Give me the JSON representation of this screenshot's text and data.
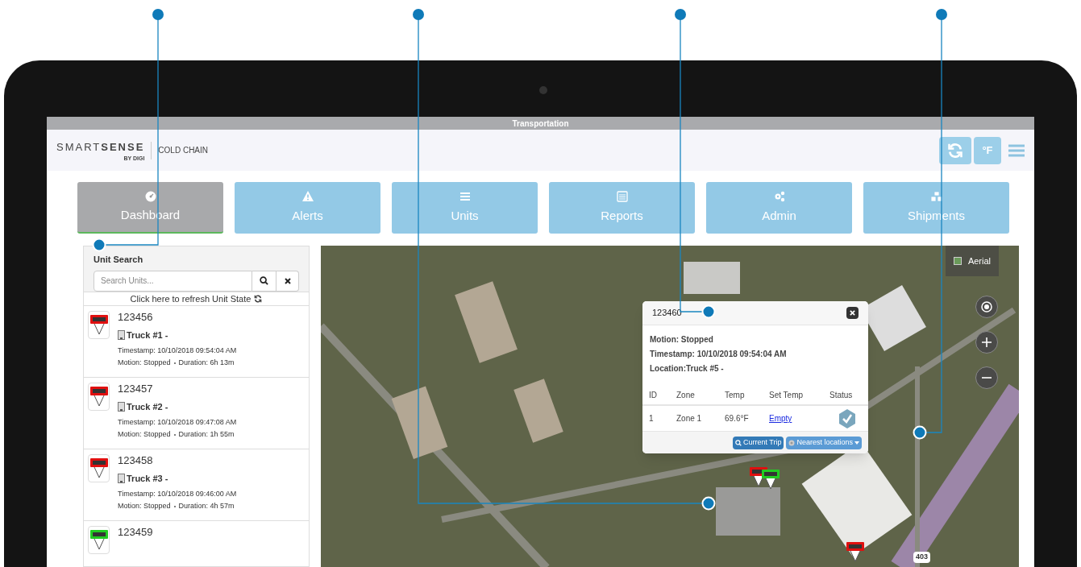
{
  "window": {
    "title": "Transportation"
  },
  "header": {
    "logo_light": "SMART",
    "logo_bold": "SENSE",
    "logo_sub": "BY DIGI",
    "product": "COLD CHAIN",
    "buttons": [
      {
        "kind": "refresh"
      },
      {
        "kind": "text",
        "label": "°F"
      },
      {
        "kind": "menu"
      }
    ]
  },
  "tabs": [
    {
      "label": "Dashboard",
      "selected": true
    },
    {
      "label": "Alerts",
      "selected": false
    },
    {
      "label": "Units",
      "selected": false
    },
    {
      "label": "Reports",
      "selected": false
    },
    {
      "label": "Admin",
      "selected": false
    },
    {
      "label": "Shipments",
      "selected": false
    }
  ],
  "sidebar": {
    "title": "Unit Search",
    "search": {
      "placeholder": "Search Units..."
    },
    "refresh_label": "Click here to refresh Unit State",
    "units": [
      {
        "id": "123456",
        "color": "#e01010",
        "name": "Truck #1 -",
        "timestamp": "Timestamp: 10/10/2018 09:54:04 AM",
        "motion": "Motion: Stopped",
        "duration": "Duration: 6h 13m"
      },
      {
        "id": "123457",
        "color": "#e01010",
        "name": "Truck #2 -",
        "timestamp": "Timestamp: 10/10/2018 09:47:08 AM",
        "motion": "Motion: Stopped",
        "duration": "Duration: 1h 55m"
      },
      {
        "id": "123458",
        "color": "#e01010",
        "name": "Truck #3 -",
        "timestamp": "Timestamp: 10/10/2018 09:46:00 AM",
        "motion": "Motion: Stopped",
        "duration": "Duration: 4h 57m"
      },
      {
        "id": "123459",
        "color": "#22cc22"
      }
    ]
  },
  "map": {
    "layer_button": "Aerial",
    "road_shield": "403",
    "markers": [
      {
        "color": "#e01010"
      },
      {
        "color": "#22cc22"
      },
      {
        "color": "#e01010"
      }
    ],
    "popup": {
      "title": "123460",
      "lines": [
        "Motion: Stopped",
        "Timestamp: 10/10/2018 09:54:04 AM",
        "Location:Truck #5 -"
      ],
      "columns": [
        "ID",
        "Zone",
        "Temp",
        "Set Temp",
        "Status"
      ],
      "rows": [
        {
          "id": "1",
          "zone": "Zone 1",
          "temp": "69.6°F",
          "set_temp": "Empty",
          "status_ok": true
        }
      ],
      "buttons": [
        {
          "kind": "primary",
          "label": "Current Trip"
        },
        {
          "kind": "dropdown",
          "label": "Nearest locations"
        }
      ]
    }
  }
}
